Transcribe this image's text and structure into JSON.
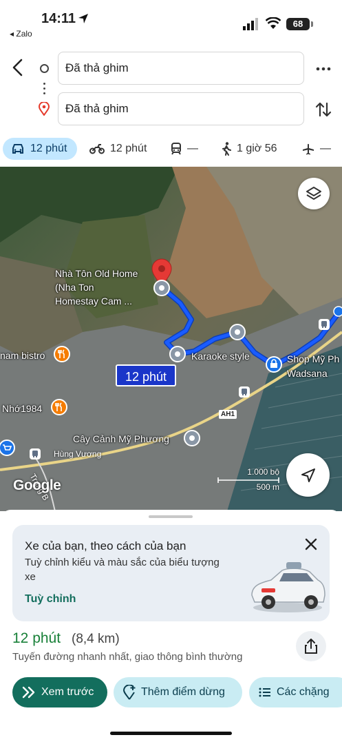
{
  "status": {
    "time": "14:11",
    "back_app": "◂ Zalo",
    "battery": "68"
  },
  "directions": {
    "origin": "Đã thả ghim",
    "destination": "Đã thả ghim"
  },
  "modes": {
    "car": "12 phút",
    "motorbike": "12 phút",
    "transit": "—",
    "walk": "1 giờ 56",
    "flight": "—"
  },
  "map": {
    "labels": {
      "nha_ton": "Nhà Tôn Old Home",
      "nha_ton_2": "(Nha Ton",
      "nha_ton_3": "Homestay Cam ...",
      "karaoke": "Karaoke style",
      "shop": "Shop Mỹ Ph",
      "shop_2": "Wadsana",
      "bistro": "nam bistro",
      "nho": "Nhớ1984",
      "cay_canh": "Cây Cảnh Mỹ Phương",
      "hung_vuong": "Hùng Vương",
      "road_ah1": "AH1",
      "road_trang": "Trang B"
    },
    "route_time": "12 phút",
    "logo": "Google",
    "scale_top": "1.000 bộ",
    "scale_bottom": "500 m"
  },
  "promo": {
    "title": "Xe của bạn, theo cách của bạn",
    "description": "Tuỳ chỉnh kiểu và màu sắc của biểu tượng xe",
    "link": "Tuỳ chỉnh"
  },
  "summary": {
    "duration": "12 phút",
    "distance": "(8,4 km)",
    "description": "Tuyến đường nhanh nhất, giao thông bình thường"
  },
  "actions": {
    "preview": "Xem trước",
    "add_stop": "Thêm điểm dừng",
    "steps": "Các chặng"
  },
  "colors": {
    "route": "#1a5cff",
    "accent_green": "#136e5d",
    "chip_blue": "#c2e7ff",
    "action_light": "#c9ecf3"
  }
}
